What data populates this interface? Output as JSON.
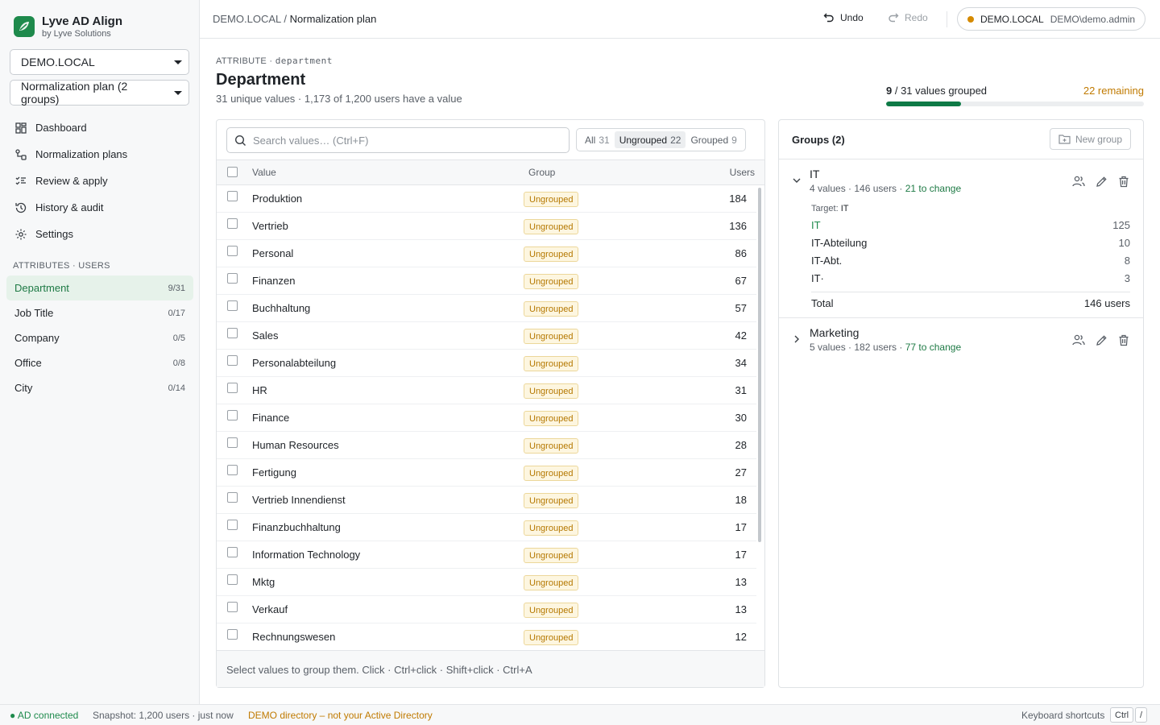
{
  "app": {
    "title": "Lyve AD Align",
    "subtitle": "by Lyve Solutions"
  },
  "sidebar": {
    "domain_select": "DEMO.LOCAL",
    "plan_select": "Normalization plan (2 groups)",
    "nav": [
      {
        "label": "Dashboard",
        "icon": "dashboard-icon"
      },
      {
        "label": "Normalization plans",
        "icon": "plans-icon"
      },
      {
        "label": "Review & apply",
        "icon": "review-icon"
      },
      {
        "label": "History & audit",
        "icon": "history-icon"
      },
      {
        "label": "Settings",
        "icon": "gear-icon"
      }
    ],
    "section_label": "ATTRIBUTES · USERS",
    "attributes": [
      {
        "label": "Department",
        "count": "9/31",
        "active": true
      },
      {
        "label": "Job Title",
        "count": "0/17"
      },
      {
        "label": "Company",
        "count": "0/5"
      },
      {
        "label": "Office",
        "count": "0/8"
      },
      {
        "label": "City",
        "count": "0/14"
      }
    ]
  },
  "topbar": {
    "breadcrumb_root": "DEMO.LOCAL",
    "breadcrumb_sep": "/",
    "breadcrumb_current": "Normalization plan",
    "undo": "Undo",
    "redo": "Redo",
    "connection_domain": "DEMO.LOCAL",
    "connection_user": "DEMO\\demo.admin",
    "connection_color": "#d58a00"
  },
  "header": {
    "attribute_prefix": "ATTRIBUTE ·",
    "attribute_key": "department",
    "title": "Department",
    "subtitle": "31 unique values · 1,173 of 1,200 users have a value",
    "progress_grouped": "9",
    "progress_rest": " / 31 values grouped",
    "progress_remaining": "22 remaining",
    "progress_fraction": 0.29
  },
  "values": {
    "search_placeholder": "Search values…  (Ctrl+F)",
    "filters": [
      {
        "label": "All",
        "count": "31"
      },
      {
        "label": "Ungrouped",
        "count": "22",
        "active": true
      },
      {
        "label": "Grouped",
        "count": "9"
      }
    ],
    "columns": {
      "value": "Value",
      "group": "Group",
      "users": "Users"
    },
    "rows": [
      {
        "value": "Produktion",
        "group": "Ungrouped",
        "users": "184"
      },
      {
        "value": "Vertrieb",
        "group": "Ungrouped",
        "users": "136"
      },
      {
        "value": "Personal",
        "group": "Ungrouped",
        "users": "86"
      },
      {
        "value": "Finanzen",
        "group": "Ungrouped",
        "users": "67"
      },
      {
        "value": "Buchhaltung",
        "group": "Ungrouped",
        "users": "57"
      },
      {
        "value": "Sales",
        "group": "Ungrouped",
        "users": "42"
      },
      {
        "value": "Personalabteilung",
        "group": "Ungrouped",
        "users": "34"
      },
      {
        "value": "HR",
        "group": "Ungrouped",
        "users": "31"
      },
      {
        "value": "Finance",
        "group": "Ungrouped",
        "users": "30"
      },
      {
        "value": "Human Resources",
        "group": "Ungrouped",
        "users": "28"
      },
      {
        "value": "Fertigung",
        "group": "Ungrouped",
        "users": "27"
      },
      {
        "value": "Vertrieb Innendienst",
        "group": "Ungrouped",
        "users": "18"
      },
      {
        "value": "Finanzbuchhaltung",
        "group": "Ungrouped",
        "users": "17"
      },
      {
        "value": "Information Technology",
        "group": "Ungrouped",
        "users": "17"
      },
      {
        "value": "Mktg",
        "group": "Ungrouped",
        "users": "13"
      },
      {
        "value": "Verkauf",
        "group": "Ungrouped",
        "users": "13"
      },
      {
        "value": "Rechnungswesen",
        "group": "Ungrouped",
        "users": "12"
      }
    ],
    "footer_hint": "Select values to group them. Click · Ctrl+click · Shift+click · Ctrl+A"
  },
  "groups": {
    "title": "Groups (2)",
    "new_group": "New group",
    "items": [
      {
        "name": "IT",
        "meta": "4 values · 146 users · ",
        "change": "21 to change",
        "target_label": "Target:",
        "target": "IT",
        "members": [
          {
            "label": "IT",
            "count": "125"
          },
          {
            "label": "IT-Abteilung",
            "count": "10"
          },
          {
            "label": "IT-Abt.",
            "count": "8"
          },
          {
            "label": "IT·",
            "count": "3"
          }
        ],
        "total_label": "Total",
        "total_value": "146 users"
      },
      {
        "name": "Marketing",
        "meta": "5 values · 182 users · ",
        "change": "77 to change"
      }
    ]
  },
  "status": {
    "connected": "● AD connected",
    "snapshot": "Snapshot: 1,200 users · just now",
    "demo_warning": "DEMO directory – not your Active Directory",
    "shortcuts_label": "Keyboard shortcuts",
    "kbd1": "Ctrl",
    "kbd2": "/"
  },
  "colors": {
    "accent": "#1e8a4c",
    "progress": "#0e7a46",
    "warning": "#c07a00"
  }
}
